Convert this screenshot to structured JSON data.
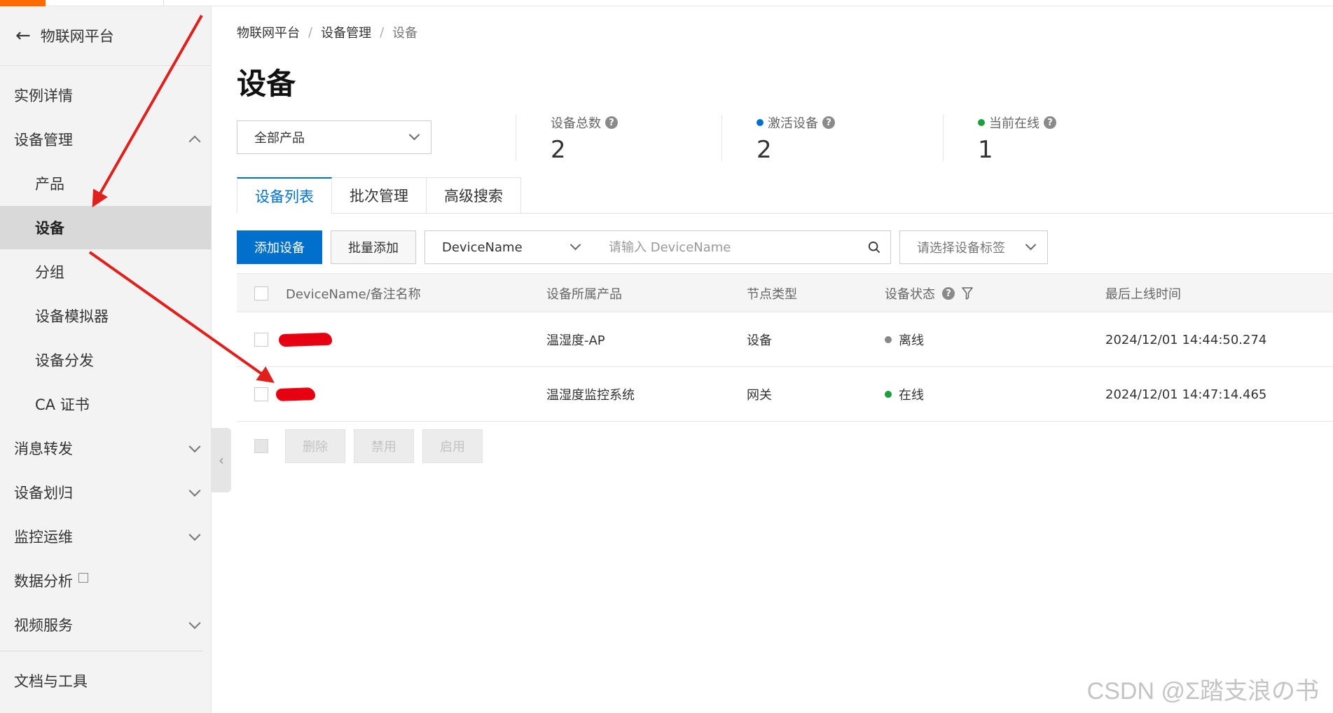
{
  "sidebar": {
    "back_label": "物联网平台",
    "items": [
      {
        "label": "实例详情",
        "level": 1,
        "chevron": ""
      },
      {
        "label": "设备管理",
        "level": 1,
        "chevron": "up"
      },
      {
        "label": "产品",
        "level": 2,
        "chevron": ""
      },
      {
        "label": "设备",
        "level": 2,
        "chevron": "",
        "active": true
      },
      {
        "label": "分组",
        "level": 2,
        "chevron": ""
      },
      {
        "label": "设备模拟器",
        "level": 2,
        "chevron": ""
      },
      {
        "label": "设备分发",
        "level": 2,
        "chevron": ""
      },
      {
        "label": "CA 证书",
        "level": 2,
        "chevron": ""
      },
      {
        "label": "消息转发",
        "level": 1,
        "chevron": "down"
      },
      {
        "label": "设备划归",
        "level": 1,
        "chevron": "down"
      },
      {
        "label": "监控运维",
        "level": 1,
        "chevron": "down"
      },
      {
        "label": "数据分析",
        "level": 1,
        "chevron": "",
        "external": true
      },
      {
        "label": "视频服务",
        "level": 1,
        "chevron": "down"
      },
      {
        "label": "文档与工具",
        "level": 1,
        "chevron": ""
      }
    ]
  },
  "breadcrumb": [
    "物联网平台",
    "设备管理",
    "设备"
  ],
  "page_title": "设备",
  "product_select": {
    "value": "全部产品"
  },
  "stats": [
    {
      "label": "设备总数",
      "value": "2",
      "dot_color": ""
    },
    {
      "label": "激活设备",
      "value": "2",
      "dot_color": "#0070cc"
    },
    {
      "label": "当前在线",
      "value": "1",
      "dot_color": "#1e9e3e"
    }
  ],
  "tabs": [
    "设备列表",
    "批次管理",
    "高级搜索"
  ],
  "toolbar": {
    "add_device": "添加设备",
    "batch_add": "批量添加",
    "filter_field": "DeviceName",
    "search_placeholder": "请输入 DeviceName",
    "tag_placeholder": "请选择设备标签"
  },
  "table": {
    "columns": [
      "DeviceName/备注名称",
      "设备所属产品",
      "节点类型",
      "设备状态",
      "最后上线时间"
    ],
    "rows": [
      {
        "product": "温湿度-AP",
        "node_type": "设备",
        "status": "离线",
        "status_color": "#888888",
        "last_online": "2024/12/01 14:44:50.274"
      },
      {
        "product": "温湿度监控系统",
        "node_type": "网关",
        "status": "在线",
        "status_color": "#1e9e3e",
        "last_online": "2024/12/01 14:47:14.465"
      }
    ]
  },
  "bulk_actions": [
    "删除",
    "禁用",
    "启用"
  ],
  "watermark": "CSDN @Σ踏支浪の书",
  "colors": {
    "primary": "#0070cc",
    "accent": "#ff6a00",
    "annotation": "#e0201b"
  }
}
